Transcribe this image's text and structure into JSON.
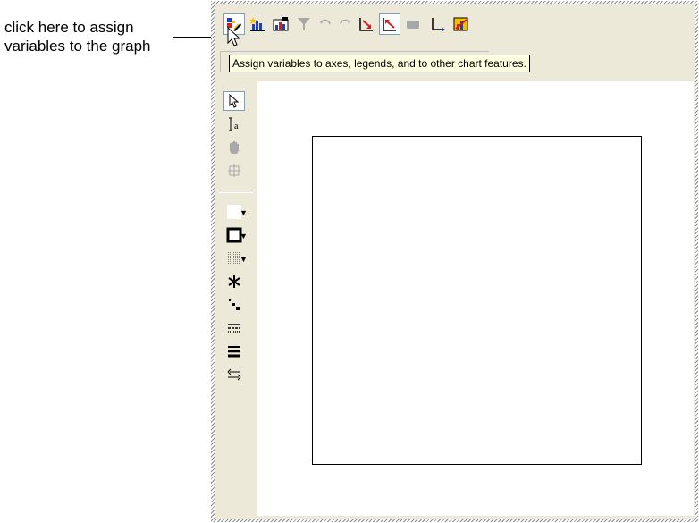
{
  "callout": {
    "line1": "click here to assign",
    "line2": "variables to the graph"
  },
  "toolbar": {
    "buttons": [
      {
        "name": "assign-variables-icon",
        "state": "pressed"
      },
      {
        "name": "new-graph-icon"
      },
      {
        "name": "graph-type-icon"
      },
      {
        "name": "filter-icon",
        "state": "disabled"
      },
      {
        "name": "undo-icon",
        "state": "disabled"
      },
      {
        "name": "redo-icon",
        "state": "disabled"
      },
      {
        "name": "axis-right-icon"
      },
      {
        "name": "axis-left-icon",
        "state": "pressed"
      },
      {
        "name": "block-icon",
        "state": "disabled"
      },
      {
        "name": "axes-icon"
      },
      {
        "name": "chart-properties-icon"
      }
    ]
  },
  "tooltip": {
    "text": "Assign variables to axes, legends, and to other chart features."
  },
  "palette": {
    "tools": [
      {
        "name": "select-arrow-icon"
      },
      {
        "name": "text-cursor-icon"
      },
      {
        "name": "hand-icon",
        "state": "disabled"
      },
      {
        "name": "zoom-box-icon",
        "state": "disabled"
      },
      {
        "name": "fill-color-icon"
      },
      {
        "name": "border-color-icon"
      },
      {
        "name": "pattern-icon"
      },
      {
        "name": "marker-star-icon"
      },
      {
        "name": "marker-size-icon"
      },
      {
        "name": "line-style-icon"
      },
      {
        "name": "line-weight-icon"
      },
      {
        "name": "swap-arrows-icon"
      }
    ]
  },
  "colors": {
    "chrome": "#ece9d8",
    "tooltip_bg": "#ffffe1",
    "canvas": "#ffffff"
  }
}
